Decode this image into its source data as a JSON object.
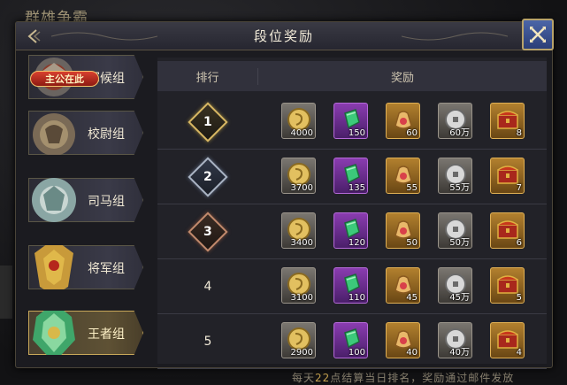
{
  "background": {
    "title": "群雄争霸"
  },
  "dialog": {
    "title": "段位奖励"
  },
  "tabs": [
    {
      "label": "军候组",
      "badge": "主公在此"
    },
    {
      "label": "校尉组"
    },
    {
      "label": "司马组"
    },
    {
      "label": "将军组"
    },
    {
      "label": "王者组"
    }
  ],
  "table": {
    "headers": {
      "rank": "排行",
      "reward": "奖励"
    },
    "rows": [
      {
        "rank": "1",
        "rewards": [
          "4000",
          "150",
          "60",
          "60万",
          "8"
        ]
      },
      {
        "rank": "2",
        "rewards": [
          "3700",
          "135",
          "55",
          "55万",
          "7"
        ]
      },
      {
        "rank": "3",
        "rewards": [
          "3400",
          "120",
          "50",
          "50万",
          "6"
        ]
      },
      {
        "rank": "4",
        "rewards": [
          "3100",
          "110",
          "45",
          "45万",
          "5"
        ]
      },
      {
        "rank": "5",
        "rewards": [
          "2900",
          "100",
          "40",
          "40万",
          "4"
        ]
      }
    ]
  },
  "footer": {
    "prefix": "每天",
    "hour": "22",
    "rest": "点结算当日排名，奖励通过邮件发放"
  },
  "icons": [
    "coin-icon",
    "jade-gem-icon",
    "money-bag-icon",
    "silver-coin-icon",
    "treasure-chest-icon"
  ],
  "colors": {
    "accent": "#c9a85a",
    "close_button": "#3b56a0"
  }
}
